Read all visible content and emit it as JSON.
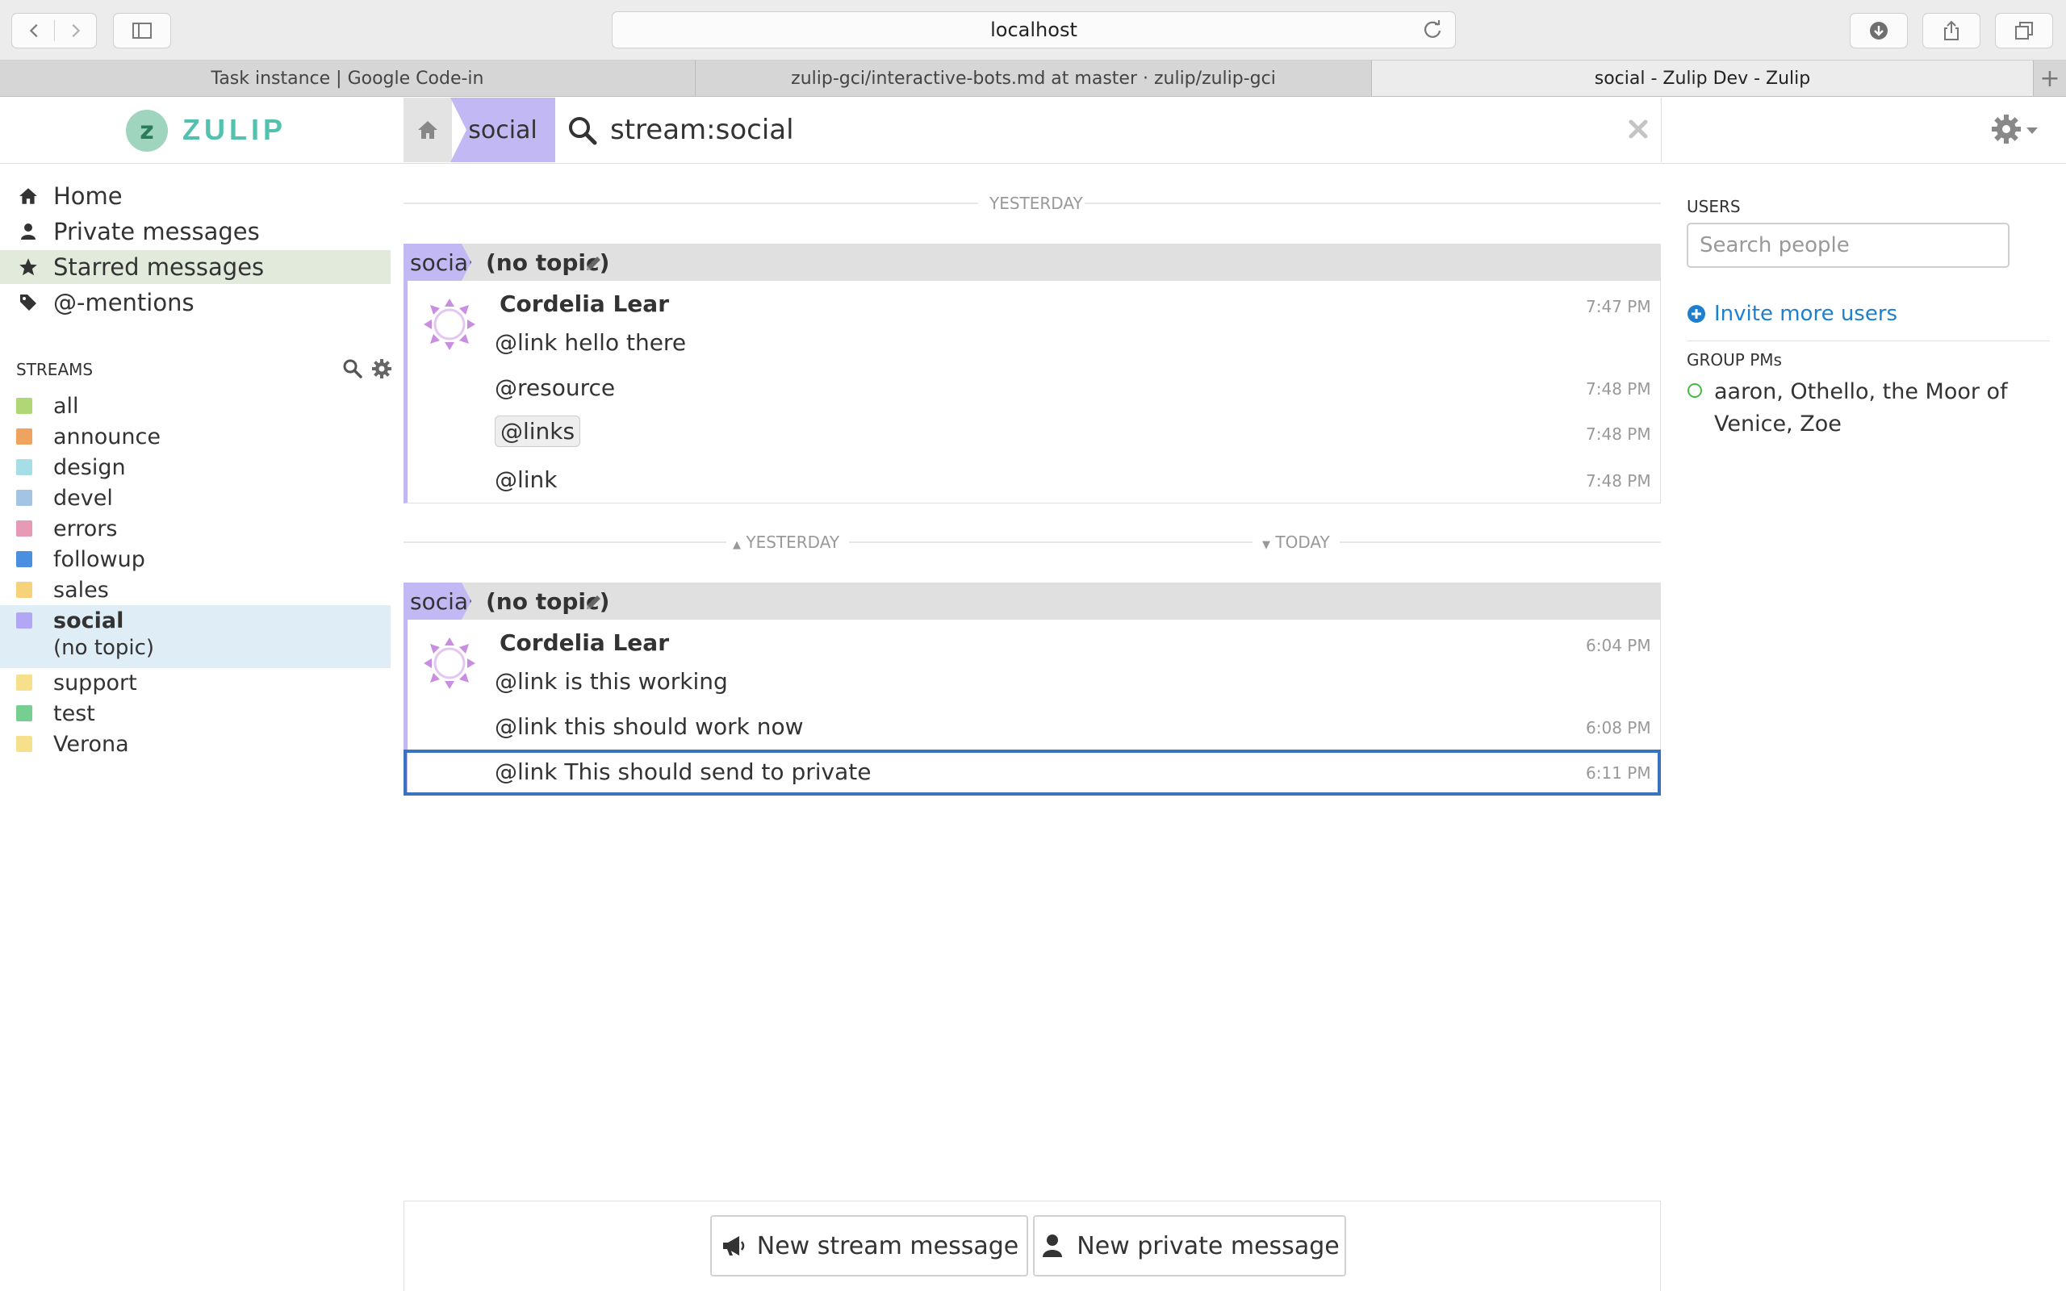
{
  "browser": {
    "url": "localhost",
    "tabs": [
      {
        "title": "Task instance | Google Code-in",
        "active": false
      },
      {
        "title": "zulip-gci/interactive-bots.md at master · zulip/zulip-gci",
        "active": false
      },
      {
        "title": "social - Zulip Dev - Zulip",
        "active": true
      }
    ],
    "new_tab_label": "+"
  },
  "header": {
    "brand": "ZULIP",
    "brand_mark": "z",
    "narrow_stream": "social",
    "search_query": "stream:social"
  },
  "left_sidebar": {
    "home_items": [
      {
        "label": "Home",
        "icon": "home-icon"
      },
      {
        "label": "Private messages",
        "icon": "user-icon"
      },
      {
        "label": "Starred messages",
        "icon": "star-icon"
      },
      {
        "label": "@-mentions",
        "icon": "tag-icon"
      }
    ],
    "streams_heading": "STREAMS",
    "streams": [
      {
        "name": "all",
        "color": "#b0d776"
      },
      {
        "name": "announce",
        "color": "#f0a35e"
      },
      {
        "name": "design",
        "color": "#a6dde6"
      },
      {
        "name": "devel",
        "color": "#a4c4e4"
      },
      {
        "name": "errors",
        "color": "#e79ab5"
      },
      {
        "name": "followup",
        "color": "#4a8fe0"
      },
      {
        "name": "sales",
        "color": "#f6d37a"
      },
      {
        "name": "social",
        "color": "#b1a7f4"
      },
      {
        "name": "support",
        "color": "#f6e08c"
      },
      {
        "name": "test",
        "color": "#76ce90"
      },
      {
        "name": "Verona",
        "color": "#f6e08c"
      }
    ],
    "active_topic": "(no topic)"
  },
  "messages": {
    "date_top": "YESTERDAY",
    "date_mid_left": "YESTERDAY",
    "date_mid_right": "TODAY",
    "groups": [
      {
        "stream": "social",
        "topic": "(no topic)",
        "sender": "Cordelia Lear",
        "messages": [
          {
            "text": "@link hello there",
            "time": "7:47 PM"
          },
          {
            "text": "@resource",
            "time": "7:48 PM"
          },
          {
            "text": "@links",
            "time": "7:48 PM"
          },
          {
            "text": "@link",
            "time": "7:48 PM"
          }
        ]
      },
      {
        "stream": "social",
        "topic": "(no topic)",
        "sender": "Cordelia Lear",
        "messages": [
          {
            "text": "@link is this working",
            "time": "6:04 PM"
          },
          {
            "text": "@link this should work now",
            "time": "6:08 PM"
          },
          {
            "text": "@link This should send to private",
            "time": "6:11 PM"
          }
        ]
      }
    ]
  },
  "right_sidebar": {
    "users_heading": "USERS",
    "search_placeholder": "Search people",
    "invite_label": "Invite more users",
    "group_pms_heading": "GROUP PMs",
    "group_pm": "aaron, Othello, the Moor of Venice, Zoe"
  },
  "compose": {
    "new_stream_label": "New stream message",
    "new_private_label": "New private message"
  }
}
